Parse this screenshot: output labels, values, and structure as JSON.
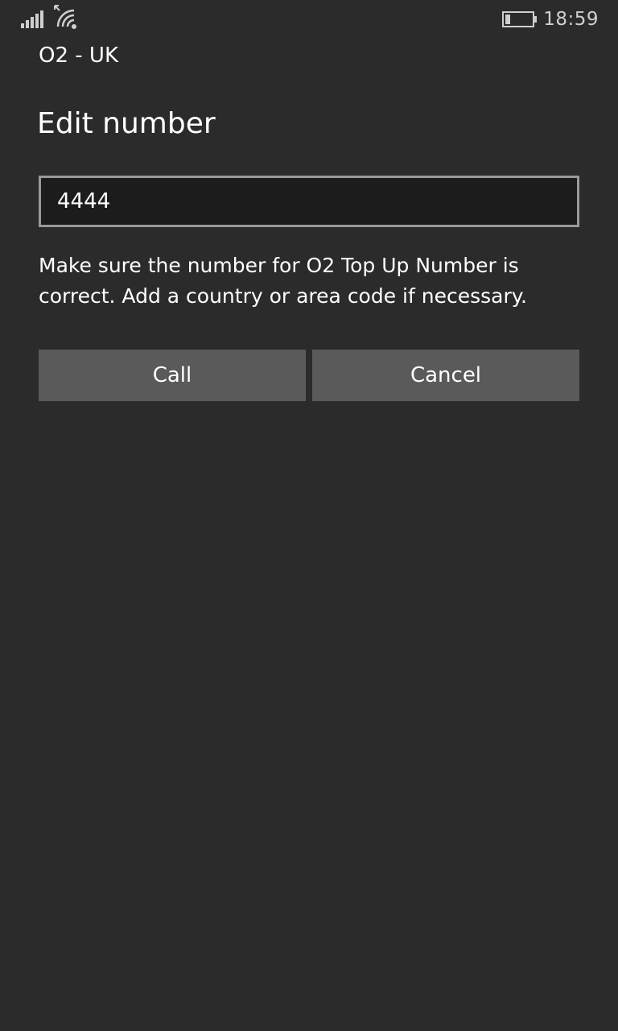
{
  "status_bar": {
    "time": "18:59",
    "icons": [
      "signal-icon",
      "wifi-icon",
      "battery-icon"
    ]
  },
  "carrier": "O2 - UK",
  "dialog": {
    "title": "Edit number",
    "number_value": "4444",
    "description": "Make sure the number for O2 Top Up Number is correct. Add a country or area code if necessary.",
    "call_label": "Call",
    "cancel_label": "Cancel"
  },
  "colors": {
    "background": "#2b2b2b",
    "input_background": "#1c1c1c",
    "input_border": "#999999",
    "button_background": "#5a5a5a",
    "text": "#ffffff"
  }
}
